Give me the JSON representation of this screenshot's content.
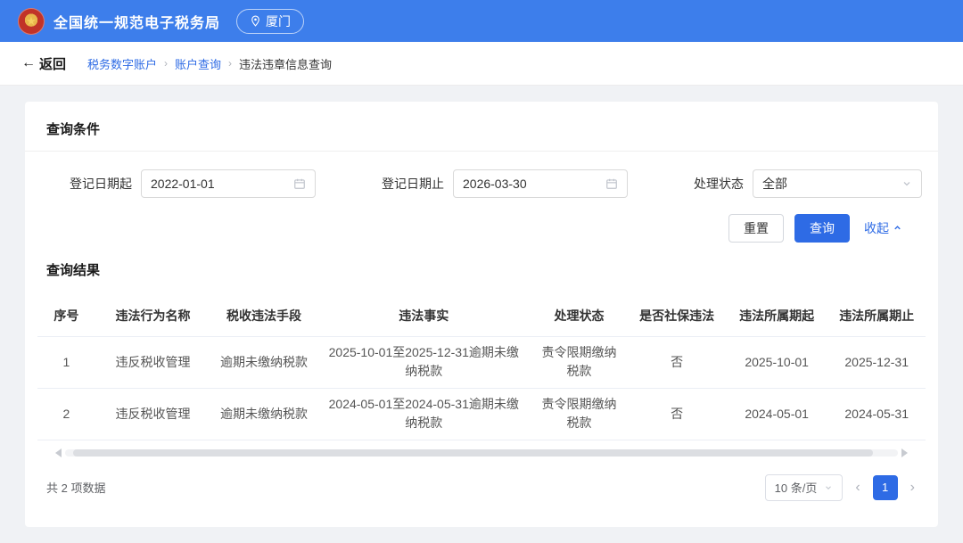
{
  "colors": {
    "header_bg": "#3D7EEB",
    "accent": "#2E6BE5"
  },
  "header": {
    "title": "全国统一规范电子税务局",
    "location": "厦门"
  },
  "nav": {
    "back_arrow": "←",
    "back_label": "返回",
    "separator": "›",
    "breadcrumb": [
      {
        "label": "税务数字账户"
      },
      {
        "label": "账户查询"
      },
      {
        "label": "违法违章信息查询"
      }
    ]
  },
  "query": {
    "title": "查询条件",
    "fields": {
      "start": {
        "label": "登记日期起",
        "value": "2022-01-01"
      },
      "end": {
        "label": "登记日期止",
        "value": "2026-03-30"
      },
      "status": {
        "label": "处理状态",
        "value": "全部"
      }
    },
    "buttons": {
      "reset": "重置",
      "search": "查询",
      "collapse": "收起"
    }
  },
  "results": {
    "title": "查询结果",
    "headers": [
      "序号",
      "违法行为名称",
      "税收违法手段",
      "违法事实",
      "处理状态",
      "是否社保违法",
      "违法所属期起",
      "违法所属期止"
    ],
    "rows": [
      [
        "1",
        "违反税收管理",
        "逾期未缴纳税款",
        "2025-10-01至2025-12-31逾期未缴纳税款",
        "责令限期缴纳税款",
        "否",
        "2025-10-01",
        "2025-12-31"
      ],
      [
        "2",
        "违反税收管理",
        "逾期未缴纳税款",
        "2024-05-01至2024-05-31逾期未缴纳税款",
        "责令限期缴纳税款",
        "否",
        "2024-05-01",
        "2024-05-31"
      ]
    ],
    "total": "共 2 项数据",
    "pagination": {
      "page_size": "10 条/页",
      "prev": "‹",
      "page": "1",
      "next": "›"
    }
  }
}
